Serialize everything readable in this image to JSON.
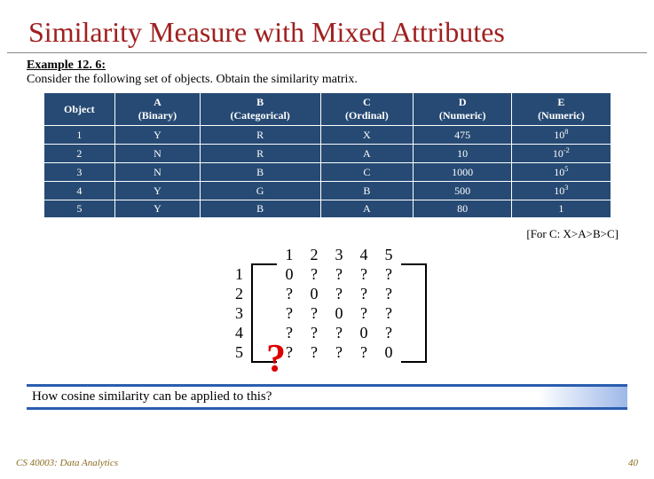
{
  "title": "Similarity Measure with Mixed Attributes",
  "example": {
    "label": "Example 12. 6:",
    "text": "Consider the following set of objects. Obtain the similarity matrix."
  },
  "table": {
    "headers": [
      "Object",
      "A\n(Binary)",
      "B\n(Categorical)",
      "C\n(Ordinal)",
      "D\n(Numeric)",
      "E\n(Numeric)"
    ],
    "rows": [
      [
        "1",
        "Y",
        "R",
        "X",
        "475",
        "10^8"
      ],
      [
        "2",
        "N",
        "R",
        "A",
        "10",
        "10^-2"
      ],
      [
        "3",
        "N",
        "B",
        "C",
        "1000",
        "10^5"
      ],
      [
        "4",
        "Y",
        "G",
        "B",
        "500",
        "10^3"
      ],
      [
        "5",
        "Y",
        "B",
        "A",
        "80",
        "1"
      ]
    ]
  },
  "ordinal_note": "[For C: X>A>B>C]",
  "matrix": {
    "col_headers": [
      "1",
      "2",
      "3",
      "4",
      "5"
    ],
    "row_headers": [
      "1",
      "2",
      "3",
      "4",
      "5"
    ],
    "cells": [
      [
        "0",
        "?",
        "?",
        "?",
        "?"
      ],
      [
        "?",
        "0",
        "?",
        "?",
        "?"
      ],
      [
        "?",
        "?",
        "0",
        "?",
        "?"
      ],
      [
        "?",
        "?",
        "?",
        "0",
        "?"
      ],
      [
        "?",
        "?",
        "?",
        "?",
        "0"
      ]
    ]
  },
  "big_question_mark": "?",
  "question_text": "How cosine similarity can be applied to this?",
  "footer": {
    "left": "CS 40003: Data Analytics",
    "right": "40"
  }
}
